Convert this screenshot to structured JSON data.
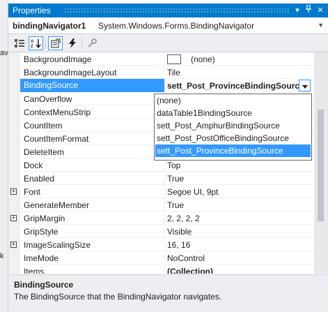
{
  "window": {
    "title": "Properties"
  },
  "left_strip": {
    "fragments": [
      "av",
      "k"
    ]
  },
  "object_selector": {
    "name": "bindingNavigator1",
    "type": "System.Windows.Forms.BindingNavigator"
  },
  "toolbar": {
    "buttons": [
      {
        "name": "categorized-icon",
        "active": false
      },
      {
        "name": "alphabetical-icon",
        "active": true
      },
      {
        "name": "properties-icon",
        "active": true
      },
      {
        "name": "events-icon",
        "active": false
      },
      {
        "name": "property-pages-icon",
        "active": false
      }
    ]
  },
  "grid": {
    "rows": [
      {
        "name": "BackgroundImage",
        "value": "(none)",
        "swatch": true
      },
      {
        "name": "BackgroundImageLayout",
        "value": "Tile"
      },
      {
        "name": "BindingSource",
        "value": "sett_Post_ProvinceBindingSource",
        "selected": true,
        "bold": true
      },
      {
        "name": "CanOverflow",
        "value": ""
      },
      {
        "name": "ContextMenuStrip",
        "value": ""
      },
      {
        "name": "CountItem",
        "value": ""
      },
      {
        "name": "CountItemFormat",
        "value": ""
      },
      {
        "name": "DeleteItem",
        "value": ""
      },
      {
        "name": "Dock",
        "value": "Top"
      },
      {
        "name": "Enabled",
        "value": "True"
      },
      {
        "name": "Font",
        "value": "Segoe UI, 9pt",
        "expandable": true
      },
      {
        "name": "GenerateMember",
        "value": "True"
      },
      {
        "name": "GripMargin",
        "value": "2, 2, 2, 2",
        "expandable": true
      },
      {
        "name": "GripStyle",
        "value": "Visible"
      },
      {
        "name": "ImageScalingSize",
        "value": "16, 16",
        "expandable": true
      },
      {
        "name": "ImeMode",
        "value": "NoControl"
      },
      {
        "name": "Items",
        "value": "(Collection)",
        "bold": true
      }
    ]
  },
  "dropdown": {
    "items": [
      "(none)",
      "dataTable1BindingSource",
      "sett_Post_AmphurBindingSource",
      "sett_Post_PostOfficeBindingSource",
      "sett_Post_ProvinceBindingSource"
    ],
    "selected_index": 4
  },
  "description": {
    "title": "BindingSource",
    "text": "The BindingSource that the BindingNavigator navigates."
  },
  "colors": {
    "accent": "#007acc",
    "selection": "#3399ff",
    "panel": "#eeeef2"
  }
}
